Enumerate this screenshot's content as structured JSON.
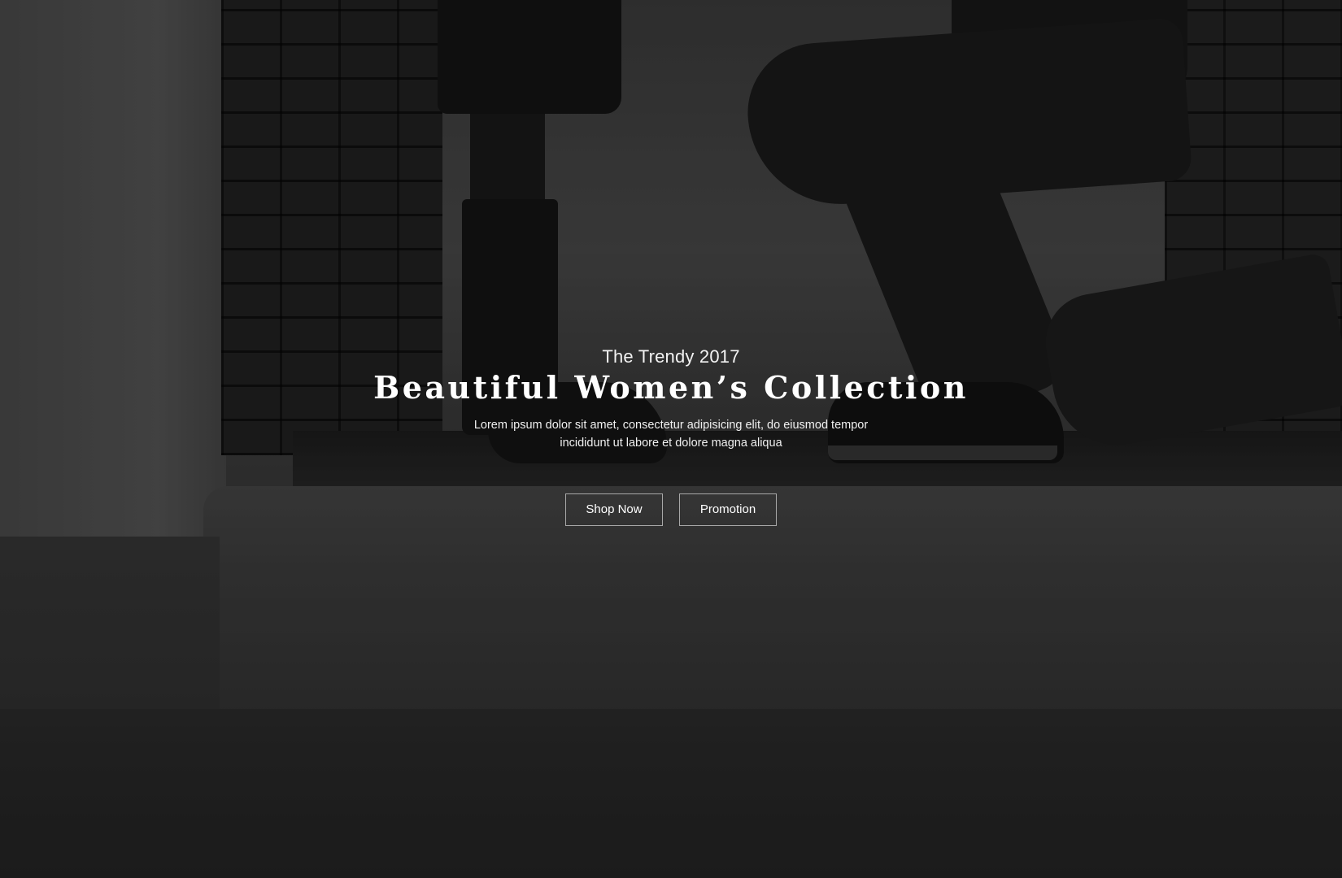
{
  "hero": {
    "eyebrow": "The Trendy 2017",
    "headline": "Beautiful Women’s Collection",
    "description_line1": "Lorem ipsum dolor sit amet, consectetur adipisicing elit, do eiusmod tempor",
    "description_line2": "incididunt ut labore et dolore magna aliqua",
    "buttons": {
      "shop_now": "Shop Now",
      "promotion": "Promotion"
    },
    "colors": {
      "text": "#ffffff",
      "button_border": "#a8a8a8"
    }
  }
}
